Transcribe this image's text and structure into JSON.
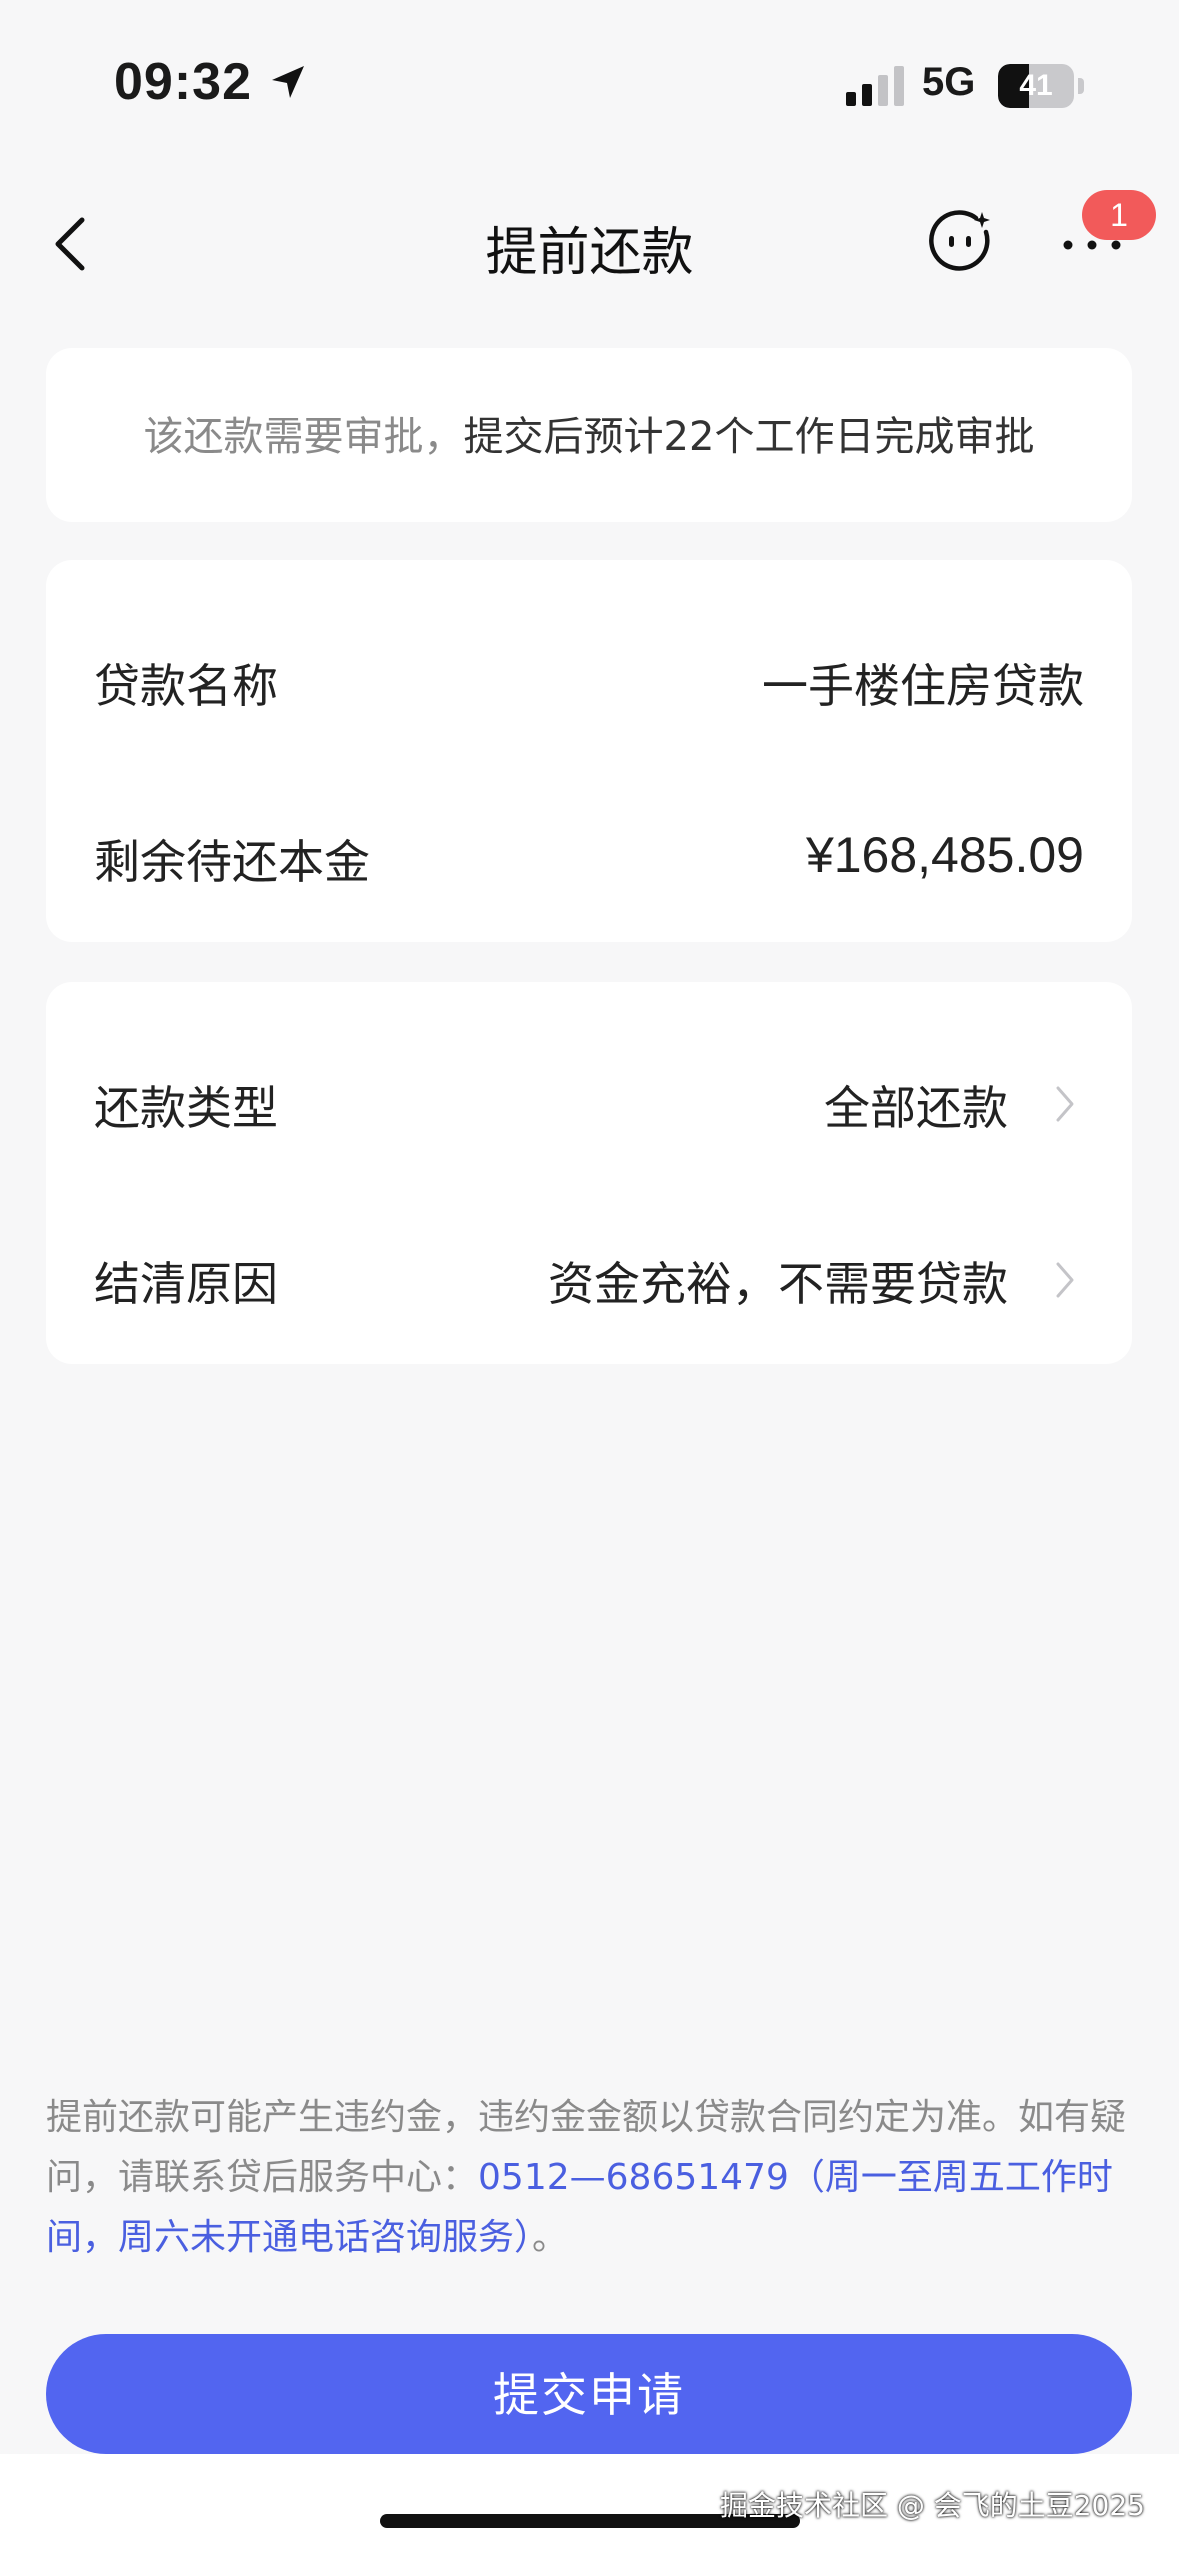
{
  "status_bar": {
    "time": "09:32",
    "network": "5G",
    "battery": "41",
    "battery_level": 0.41
  },
  "nav": {
    "title": "提前还款",
    "badge_count": "1"
  },
  "notice": {
    "muted": "该还款需要审批，",
    "main": "提交后预计22个工作日完成审批"
  },
  "loan": {
    "name_label": "贷款名称",
    "name_value": "一手楼住房贷款",
    "principal_label": "剩余待还本金",
    "principal_value": "¥168,485.09"
  },
  "repayment": {
    "type_label": "还款类型",
    "type_value": "全部还款",
    "reason_label": "结清原因",
    "reason_value": "资金充裕，不需要贷款"
  },
  "disclaimer": {
    "text": "提前还款可能产生违约金，违约金金额以贷款合同约定为准。如有疑问，请联系贷后服务中心：",
    "phone_link": "0512—68651479（周一至周五工作时间，周六未开通电话咨询服务）",
    "suffix": "。"
  },
  "submit_label": "提交申请",
  "watermark": "掘金技术社区 @ 会飞的土豆2025",
  "colors": {
    "accent": "#5265f0",
    "link": "#4a5fe0",
    "badge": "#f25a5a",
    "background": "#f7f7f8"
  }
}
